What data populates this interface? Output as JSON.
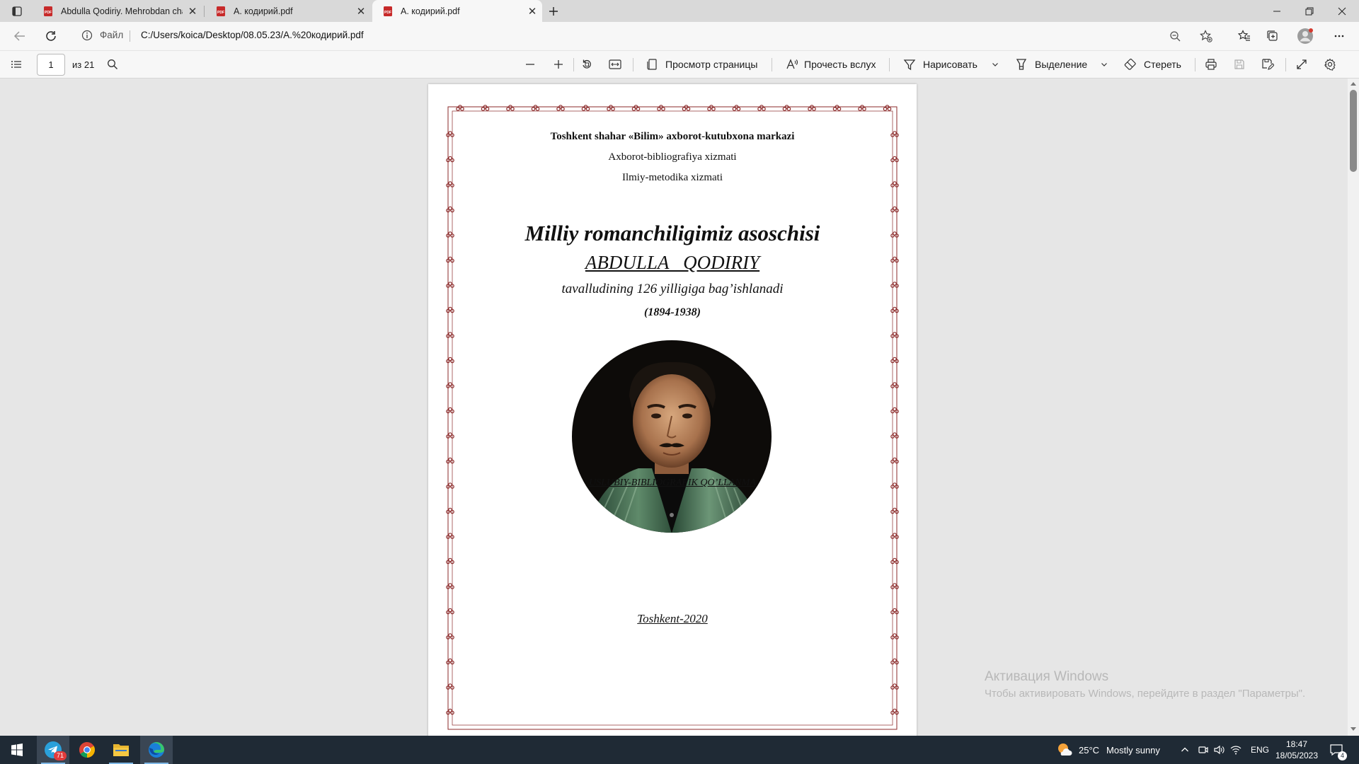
{
  "tabs": [
    {
      "title": "Abdulla Qodiriy. Mehrobdan chayon",
      "icon": "pdf-file-icon"
    },
    {
      "title": "А. кодирий.pdf",
      "icon": "pdf-file-icon"
    },
    {
      "title": "А. кодирий.pdf",
      "icon": "pdf-file-icon",
      "active": true
    }
  ],
  "address": {
    "site_label": "Файл",
    "url": "C:/Users/koica/Desktop/08.05.23/A.%20кодирий.pdf"
  },
  "pdf_toolbar": {
    "page_number": "1",
    "page_total": "из 21",
    "page_view": "Просмотр страницы",
    "read_aloud": "Прочесть вслух",
    "draw": "Нарисовать",
    "highlight": "Выделение",
    "erase": "Стереть"
  },
  "document": {
    "org_line": "Toshkent  shahar «Bilim» axborot-kutubxona markazi",
    "dept_line1": "Axborot-bibliografiya xizmati",
    "dept_line2": "Ilmiy-metodika xizmati",
    "title_line": "Milliy romanchiligimiz asoschisi",
    "name_line": "ABDULLA   QODIRIY",
    "subtitle_line": "tavalludining 126 yilligiga bag’ishlanadi",
    "years_line": "(1894-1938)",
    "doc_type": "USLUBIY-BIBLIOGRAFIK QO’LLANMA",
    "city_year": "Toshkent-2020"
  },
  "watermark": {
    "title": "Активация Windows",
    "text": "Чтобы активировать Windows, перейдите в раздел \"Параметры\"."
  },
  "taskbar": {
    "telegram_badge": "71",
    "weather_temp": "25°C",
    "weather_text": "Mostly sunny",
    "language": "ENG",
    "time": "18:47",
    "date": "18/05/2023",
    "notifications": "4"
  },
  "colors": {
    "accent": "#0067c0",
    "pdf_red": "#c72a2a",
    "border_ornament": "#8b2a2a",
    "taskbar": "#1f2a35"
  }
}
